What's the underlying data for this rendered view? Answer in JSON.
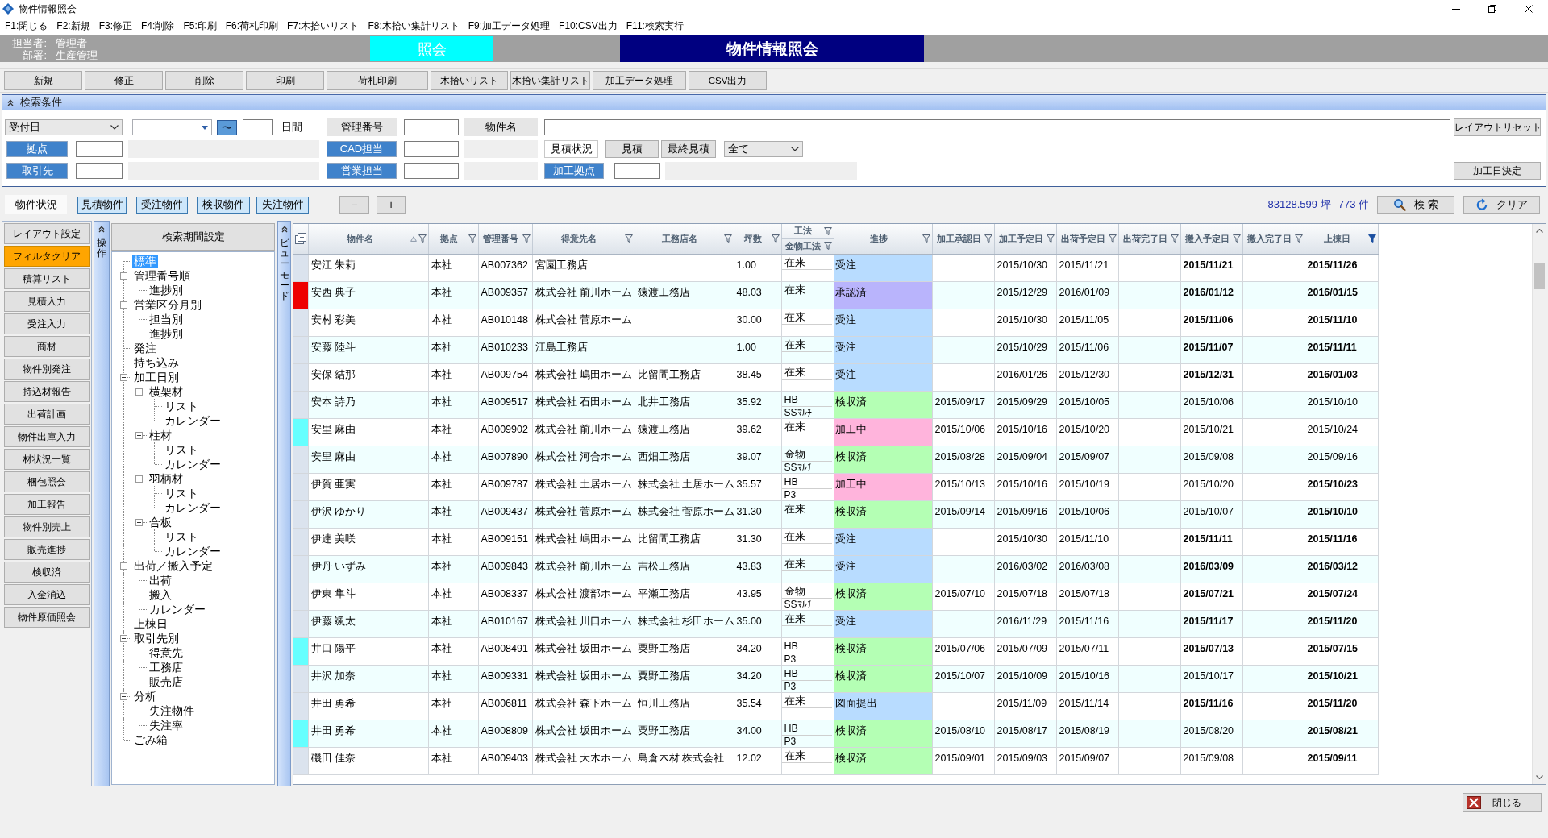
{
  "window": {
    "title": "物件情報照会"
  },
  "menu": [
    "F1:閉じる",
    "F2:新規",
    "F3:修正",
    "F4:削除",
    "F5:印刷",
    "F6:荷札印刷",
    "F7:木拾いリスト",
    "F8:木拾い集計リスト",
    "F9:加工データ処理",
    "F10:CSV出力",
    "F11:検索実行"
  ],
  "header": {
    "staff_label": "担当者:",
    "staff": "管理者",
    "department_label": "部署:",
    "department": "生産管理",
    "mode": "照会",
    "screen_title": "物件情報照会"
  },
  "toolbar": [
    "新規",
    "修正",
    "削除",
    "印刷",
    "荷札印刷",
    "木拾いリスト",
    "木拾い集計リスト",
    "加工データ処理",
    "CSV出力"
  ],
  "search": {
    "title": "検索条件",
    "date_type": "受付日",
    "range_button": "〜",
    "days_unit": "日間",
    "management_no_label": "管理番号",
    "property_name_label": "物件名",
    "layout_reset_button": "レイアウトリセット",
    "base_button": "拠点",
    "cad_button": "CAD担当",
    "estimate_status_label": "見積状況",
    "estimate_buttons": [
      "見積",
      "最終見積"
    ],
    "estimate_filter": "全て",
    "client_button": "取引先",
    "sales_button": "営業担当",
    "factory_button": "加工拠点",
    "process_date_button": "加工日決定"
  },
  "status_filter": {
    "label": "物件状況",
    "buttons": [
      "見積物件",
      "受注物件",
      "検収物件",
      "失注物件"
    ],
    "minus": "−",
    "plus": "+",
    "total_area": "83128.599 坪",
    "total_count": "773 件",
    "search_button": "検 索",
    "clear_button": "クリア"
  },
  "sidebar": {
    "buttons": [
      {
        "label": "レイアウト設定",
        "highlighted": false
      },
      {
        "label": "フィルタクリア",
        "highlighted": true
      },
      {
        "label": "積算リスト",
        "highlighted": false
      },
      {
        "label": "見積入力",
        "highlighted": false
      },
      {
        "label": "受注入力",
        "highlighted": false
      },
      {
        "label": "商材",
        "highlighted": false
      },
      {
        "label": "物件別発注",
        "highlighted": false
      },
      {
        "label": "持込材報告",
        "highlighted": false
      },
      {
        "label": "出荷計画",
        "highlighted": false
      },
      {
        "label": "物件出庫入力",
        "highlighted": false
      },
      {
        "label": "材状況一覧",
        "highlighted": false
      },
      {
        "label": "梱包照会",
        "highlighted": false
      },
      {
        "label": "加工報告",
        "highlighted": false
      },
      {
        "label": "物件別売上",
        "highlighted": false
      },
      {
        "label": "販売進捗",
        "highlighted": false
      },
      {
        "label": "検収済",
        "highlighted": false
      },
      {
        "label": "入金消込",
        "highlighted": false
      },
      {
        "label": "物件原価照会",
        "highlighted": false
      }
    ],
    "strip_label": "操作"
  },
  "tree": {
    "title": "検索期間設定",
    "items": [
      {
        "label": "標準",
        "selected": true
      },
      {
        "label": "管理番号順",
        "selected": false,
        "expanded": true,
        "children": [
          {
            "label": "進捗別",
            "selected": false
          }
        ]
      },
      {
        "label": "営業区分月別",
        "selected": false,
        "expanded": true,
        "children": [
          {
            "label": "担当別",
            "selected": false
          },
          {
            "label": "進捗別",
            "selected": false
          }
        ]
      },
      {
        "label": "発注",
        "selected": false
      },
      {
        "label": "持ち込み",
        "selected": false
      },
      {
        "label": "加工日別",
        "selected": false,
        "expanded": true,
        "children": [
          {
            "label": "横架材",
            "selected": false,
            "expanded": true,
            "children": [
              {
                "label": "リスト",
                "selected": false
              },
              {
                "label": "カレンダー",
                "selected": false
              }
            ]
          },
          {
            "label": "柱材",
            "selected": false,
            "expanded": true,
            "children": [
              {
                "label": "リスト",
                "selected": false
              },
              {
                "label": "カレンダー",
                "selected": false
              }
            ]
          },
          {
            "label": "羽柄材",
            "selected": false,
            "expanded": true,
            "children": [
              {
                "label": "リスト",
                "selected": false
              },
              {
                "label": "カレンダー",
                "selected": false
              }
            ]
          },
          {
            "label": "合板",
            "selected": false,
            "expanded": true,
            "children": [
              {
                "label": "リスト",
                "selected": false
              },
              {
                "label": "カレンダー",
                "selected": false
              }
            ]
          }
        ]
      },
      {
        "label": "出荷／搬入予定",
        "selected": false,
        "expanded": true,
        "children": [
          {
            "label": "出荷",
            "selected": false
          },
          {
            "label": "搬入",
            "selected": false
          },
          {
            "label": "カレンダー",
            "selected": false
          }
        ]
      },
      {
        "label": "上棟日",
        "selected": false
      },
      {
        "label": "取引先別",
        "selected": false,
        "expanded": true,
        "children": [
          {
            "label": "得意先",
            "selected": false
          },
          {
            "label": "工務店",
            "selected": false
          },
          {
            "label": "販売店",
            "selected": false
          }
        ]
      },
      {
        "label": "分析",
        "selected": false,
        "expanded": true,
        "children": [
          {
            "label": "失注物件",
            "selected": false
          },
          {
            "label": "失注率",
            "selected": false
          }
        ]
      },
      {
        "label": "ごみ箱",
        "selected": false
      }
    ]
  },
  "view_strip": {
    "label": "ビューモード"
  },
  "table": {
    "columns": [
      {
        "label": "物件名",
        "sorted": true,
        "filtered": false
      },
      {
        "label": "拠点",
        "sorted": false,
        "filtered": false
      },
      {
        "label": "管理番号",
        "sorted": false,
        "filtered": false
      },
      {
        "label": "得意先名",
        "sorted": false,
        "filtered": false
      },
      {
        "label": "工務店名",
        "sorted": false,
        "filtered": false
      },
      {
        "label": "坪数",
        "sorted": false,
        "filtered": false
      },
      {
        "label": "工法",
        "sorted": false,
        "filtered": false,
        "sub_column": {
          "label": "金物工法",
          "filtered": false
        }
      },
      {
        "label": "進捗",
        "sorted": false,
        "filtered": false
      },
      {
        "label": "加工承認日",
        "sorted": false,
        "filtered": false
      },
      {
        "label": "加工予定日",
        "sorted": false,
        "filtered": false
      },
      {
        "label": "出荷予定日",
        "sorted": false,
        "filtered": false
      },
      {
        "label": "出荷完了日",
        "sorted": false,
        "filtered": false
      },
      {
        "label": "搬入予定日",
        "sorted": false,
        "filtered": false
      },
      {
        "label": "搬入完了日",
        "sorted": false,
        "filtered": false
      },
      {
        "label": "上棟日",
        "sorted": false,
        "filtered": true
      }
    ],
    "rows": [
      {
        "name": "安江 朱莉",
        "base": "本社",
        "number": "AB007362",
        "client": "宮園工務店",
        "tsubo": "1.00",
        "method": "在来",
        "progress": {
          "text": "受注",
          "color": "#b8dcff"
        },
        "process_planned": "2015/10/30",
        "ship_planned": "2015/11/21",
        "delivery_planned": {
          "text": "2015/11/21",
          "bold": true
        },
        "raising": {
          "text": "2015/11/26",
          "bold": true
        }
      },
      {
        "color": "#ee0000",
        "name": "安西 典子",
        "base": "本社",
        "number": "AB009357",
        "client": "株式会社 前川ホーム",
        "builder": "猿渡工務店",
        "tsubo": "48.03",
        "method": "在来",
        "progress": {
          "text": "承認済",
          "color": "#b9b4fc"
        },
        "process_planned": "2015/12/29",
        "ship_planned": "2016/01/09",
        "delivery_planned": {
          "text": "2016/01/12",
          "bold": true
        },
        "raising": {
          "text": "2016/01/15",
          "bold": true
        }
      },
      {
        "name": "安村 彩美",
        "base": "本社",
        "number": "AB010148",
        "client": "株式会社 菅原ホーム",
        "tsubo": "30.00",
        "method": "在来",
        "progress": {
          "text": "受注",
          "color": "#b8dcff"
        },
        "process_planned": "2015/10/30",
        "ship_planned": "2015/11/05",
        "delivery_planned": {
          "text": "2015/11/06",
          "bold": true
        },
        "raising": {
          "text": "2015/11/10",
          "bold": true
        }
      },
      {
        "name": "安藤 陸斗",
        "base": "本社",
        "number": "AB010233",
        "client": "江島工務店",
        "tsubo": "1.00",
        "method": "在来",
        "progress": {
          "text": "受注",
          "color": "#b8dcff"
        },
        "process_planned": "2015/10/29",
        "ship_planned": "2015/11/06",
        "delivery_planned": {
          "text": "2015/11/07",
          "bold": true
        },
        "raising": {
          "text": "2015/11/11",
          "bold": true
        }
      },
      {
        "name": "安保 結那",
        "base": "本社",
        "number": "AB009754",
        "client": "株式会社 嶋田ホーム",
        "builder": "比留間工務店",
        "tsubo": "38.45",
        "method": "在来",
        "progress": {
          "text": "受注",
          "color": "#b8dcff"
        },
        "process_planned": "2016/01/26",
        "ship_planned": "2015/12/30",
        "delivery_planned": {
          "text": "2015/12/31",
          "bold": true
        },
        "raising": {
          "text": "2016/01/03",
          "bold": true
        }
      },
      {
        "name": "安本 詩乃",
        "base": "本社",
        "number": "AB009517",
        "client": "株式会社 石田ホーム",
        "builder": "北井工務店",
        "tsubo": "35.92",
        "method": "HB",
        "hardware": "SSﾏﾙﾁ",
        "progress": {
          "text": "検収済",
          "color": "#b4ffb4"
        },
        "approval": "2015/09/17",
        "process_planned": "2015/09/29",
        "ship_planned": "2015/10/05",
        "delivery_planned": {
          "text": "2015/10/06",
          "bold": false
        },
        "raising": {
          "text": "2015/10/10",
          "bold": false
        }
      },
      {
        "color": "#66ffff",
        "name": "安里 麻由",
        "base": "本社",
        "number": "AB009902",
        "client": "株式会社 前川ホーム",
        "builder": "猿渡工務店",
        "tsubo": "39.62",
        "method": "在来",
        "progress": {
          "text": "加工中",
          "color": "#ffb4dc"
        },
        "approval": "2015/10/06",
        "process_planned": "2015/10/16",
        "ship_planned": "2015/10/20",
        "delivery_planned": {
          "text": "2015/10/21",
          "bold": false
        },
        "raising": {
          "text": "2015/10/24",
          "bold": false
        }
      },
      {
        "name": "安里 麻由",
        "base": "本社",
        "number": "AB007890",
        "client": "株式会社 河合ホーム",
        "builder": "西畑工務店",
        "tsubo": "39.07",
        "method": "金物",
        "hardware": "SSﾏﾙﾁ",
        "progress": {
          "text": "検収済",
          "color": "#b4ffb4"
        },
        "approval": "2015/08/28",
        "process_planned": "2015/09/04",
        "ship_planned": "2015/09/07",
        "delivery_planned": {
          "text": "2015/09/08",
          "bold": false
        },
        "raising": {
          "text": "2015/09/16",
          "bold": false
        }
      },
      {
        "name": "伊賀 亜実",
        "base": "本社",
        "number": "AB009787",
        "client": "株式会社 土居ホーム",
        "builder": "株式会社 土居ホーム",
        "tsubo": "35.57",
        "method": "HB",
        "hardware": "P3",
        "progress": {
          "text": "加工中",
          "color": "#ffb4dc"
        },
        "approval": "2015/10/13",
        "process_planned": "2015/10/16",
        "ship_planned": "2015/10/19",
        "delivery_planned": {
          "text": "2015/10/20",
          "bold": false
        },
        "raising": {
          "text": "2015/10/23",
          "bold": true
        }
      },
      {
        "name": "伊沢 ゆかり",
        "base": "本社",
        "number": "AB009437",
        "client": "株式会社 菅原ホーム",
        "builder": "株式会社 菅原ホーム",
        "tsubo": "31.30",
        "method": "在来",
        "progress": {
          "text": "検収済",
          "color": "#b4ffb4"
        },
        "approval": "2015/09/14",
        "process_planned": "2015/09/16",
        "ship_planned": "2015/10/06",
        "delivery_planned": {
          "text": "2015/10/07",
          "bold": false
        },
        "raising": {
          "text": "2015/10/10",
          "bold": true
        }
      },
      {
        "name": "伊達 美咲",
        "base": "本社",
        "number": "AB009151",
        "client": "株式会社 嶋田ホーム",
        "builder": "比留間工務店",
        "tsubo": "31.30",
        "method": "在来",
        "progress": {
          "text": "受注",
          "color": "#b8dcff"
        },
        "process_planned": "2015/10/30",
        "ship_planned": "2015/11/10",
        "delivery_planned": {
          "text": "2015/11/11",
          "bold": true
        },
        "raising": {
          "text": "2015/11/16",
          "bold": true
        }
      },
      {
        "name": "伊丹 いずみ",
        "base": "本社",
        "number": "AB009843",
        "client": "株式会社 前川ホーム",
        "builder": "吉松工務店",
        "tsubo": "43.83",
        "method": "在来",
        "progress": {
          "text": "受注",
          "color": "#b8dcff"
        },
        "process_planned": "2016/03/02",
        "ship_planned": "2016/03/08",
        "delivery_planned": {
          "text": "2016/03/09",
          "bold": true
        },
        "raising": {
          "text": "2016/03/12",
          "bold": true
        }
      },
      {
        "name": "伊東 隼斗",
        "base": "本社",
        "number": "AB008337",
        "client": "株式会社 渡部ホーム",
        "builder": "平瀬工務店",
        "tsubo": "43.95",
        "method": "金物",
        "hardware": "SSﾏﾙﾁ",
        "progress": {
          "text": "検収済",
          "color": "#b4ffb4"
        },
        "approval": "2015/07/10",
        "process_planned": "2015/07/18",
        "ship_planned": "2015/07/18",
        "delivery_planned": {
          "text": "2015/07/21",
          "bold": true
        },
        "raising": {
          "text": "2015/07/24",
          "bold": true
        }
      },
      {
        "name": "伊藤 颯太",
        "base": "本社",
        "number": "AB010167",
        "client": "株式会社 川口ホーム",
        "builder": "株式会社 杉田ホーム",
        "tsubo": "35.00",
        "method": "在来",
        "progress": {
          "text": "受注",
          "color": "#b8dcff"
        },
        "process_planned": "2016/11/29",
        "ship_planned": "2015/11/16",
        "delivery_planned": {
          "text": "2015/11/17",
          "bold": true
        },
        "raising": {
          "text": "2015/11/20",
          "bold": true
        }
      },
      {
        "color": "#66ffff",
        "name": "井口 陽平",
        "base": "本社",
        "number": "AB008491",
        "client": "株式会社 坂田ホーム",
        "builder": "粟野工務店",
        "tsubo": "34.20",
        "method": "HB",
        "hardware": "P3",
        "progress": {
          "text": "検収済",
          "color": "#b4ffb4"
        },
        "approval": "2015/07/06",
        "process_planned": "2015/07/09",
        "ship_planned": "2015/07/11",
        "delivery_planned": {
          "text": "2015/07/13",
          "bold": true
        },
        "raising": {
          "text": "2015/07/15",
          "bold": true
        }
      },
      {
        "name": "井沢 加奈",
        "base": "本社",
        "number": "AB009331",
        "client": "株式会社 坂田ホーム",
        "builder": "粟野工務店",
        "tsubo": "34.20",
        "method": "HB",
        "hardware": "P3",
        "progress": {
          "text": "検収済",
          "color": "#b4ffb4"
        },
        "approval": "2015/10/07",
        "process_planned": "2015/10/09",
        "ship_planned": "2015/10/16",
        "delivery_planned": {
          "text": "2015/10/17",
          "bold": false
        },
        "raising": {
          "text": "2015/10/21",
          "bold": true
        }
      },
      {
        "name": "井田 勇希",
        "base": "本社",
        "number": "AB006811",
        "client": "株式会社 森下ホーム",
        "builder": "恒川工務店",
        "tsubo": "35.54",
        "method": "在来",
        "progress": {
          "text": "図面提出",
          "color": "#b8dcff"
        },
        "process_planned": "2015/11/09",
        "ship_planned": "2015/11/14",
        "delivery_planned": {
          "text": "2015/11/16",
          "bold": true
        },
        "raising": {
          "text": "2015/11/20",
          "bold": true
        }
      },
      {
        "color": "#66ffff",
        "name": "井田 勇希",
        "base": "本社",
        "number": "AB008809",
        "client": "株式会社 坂田ホーム",
        "builder": "粟野工務店",
        "tsubo": "34.00",
        "method": "HB",
        "hardware": "P3",
        "progress": {
          "text": "検収済",
          "color": "#b4ffb4"
        },
        "approval": "2015/08/10",
        "process_planned": "2015/08/17",
        "ship_planned": "2015/08/19",
        "delivery_planned": {
          "text": "2015/08/20",
          "bold": false
        },
        "raising": {
          "text": "2015/08/21",
          "bold": true
        }
      },
      {
        "name": "磯田 佳奈",
        "base": "本社",
        "number": "AB009403",
        "client": "株式会社 大木ホーム",
        "builder": "島倉木材 株式会社",
        "tsubo": "12.02",
        "method": "在来",
        "progress": {
          "text": "検収済",
          "color": "#b4ffb4"
        },
        "approval": "2015/09/01",
        "process_planned": "2015/09/03",
        "ship_planned": "2015/09/07",
        "delivery_planned": {
          "text": "2015/09/08",
          "bold": false
        },
        "raising": {
          "text": "2015/09/11",
          "bold": true
        }
      }
    ]
  },
  "footer": {
    "close_button": "閉じる"
  }
}
